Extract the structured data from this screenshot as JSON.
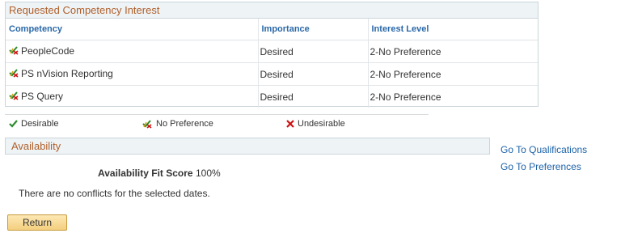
{
  "competency_panel": {
    "title": "Requested Competency Interest",
    "columns": [
      "Competency",
      "Importance",
      "Interest Level"
    ],
    "rows": [
      {
        "icon": "no-preference-icon",
        "competency": "PeopleCode",
        "importance": "Desired",
        "interest": "2-No Preference"
      },
      {
        "icon": "no-preference-icon",
        "competency": "PS nVision Reporting",
        "importance": "Desired",
        "interest": "2-No Preference"
      },
      {
        "icon": "no-preference-icon",
        "competency": "PS Query",
        "importance": "Desired",
        "interest": "2-No Preference"
      }
    ]
  },
  "legend": {
    "desirable": "Desirable",
    "no_preference": "No Preference",
    "undesirable": "Undesirable"
  },
  "availability": {
    "title": "Availability",
    "fit_score_label": "Availability Fit Score",
    "fit_score_value": "100%",
    "conflicts_text": "There are no conflicts for the selected dates."
  },
  "links": {
    "qualifications": "Go To Qualifications",
    "preferences": "Go To Preferences"
  },
  "buttons": {
    "return": "Return"
  },
  "colors": {
    "section_title": "#b1602b",
    "header_text": "#2a68a8",
    "link": "#1d63a8",
    "desirable_check": "#2e8b2e",
    "undesirable_x": "#cc1111"
  }
}
